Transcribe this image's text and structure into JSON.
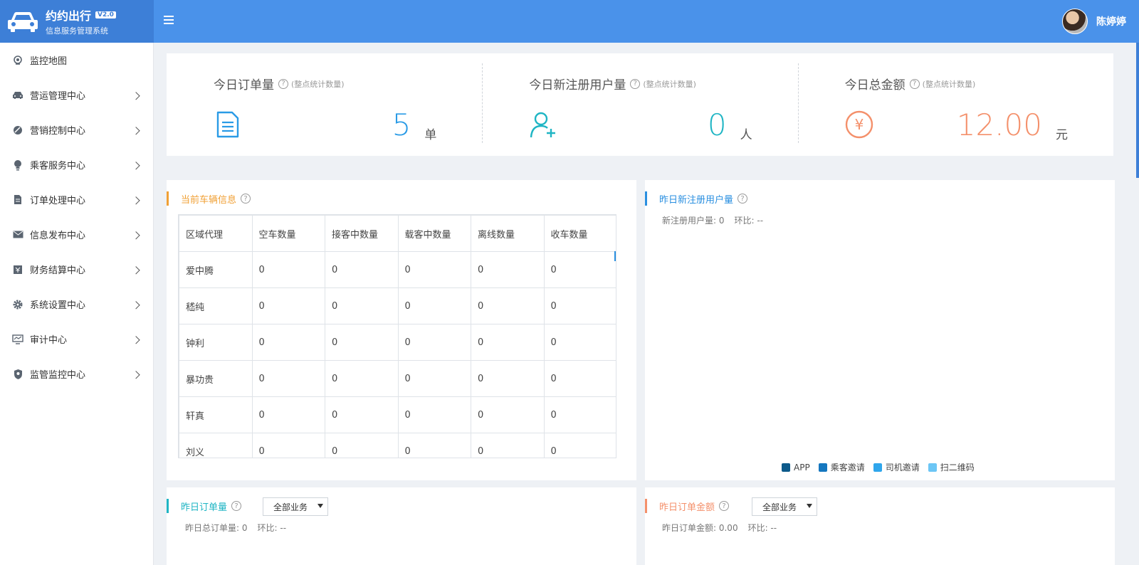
{
  "brand": {
    "name": "约约出行",
    "version": "V2.0",
    "subtitle": "信息服务管理系统"
  },
  "user": {
    "name": "陈婷婷"
  },
  "sidebar": {
    "items": [
      {
        "label": "监控地图",
        "icon": "map-pin-icon"
      },
      {
        "label": "营运管理中心",
        "icon": "car-icon"
      },
      {
        "label": "营销控制中心",
        "icon": "tag-icon"
      },
      {
        "label": "乘客服务中心",
        "icon": "bulb-icon"
      },
      {
        "label": "订单处理中心",
        "icon": "file-icon"
      },
      {
        "label": "信息发布中心",
        "icon": "mail-icon"
      },
      {
        "label": "财务结算中心",
        "icon": "cash-icon"
      },
      {
        "label": "系统设置中心",
        "icon": "gear-icon"
      },
      {
        "label": "审计中心",
        "icon": "monitor-icon"
      },
      {
        "label": "监管监控中心",
        "icon": "shield-icon"
      }
    ]
  },
  "stats": {
    "note": "(整点统计数量)",
    "orders": {
      "title": "今日订单量",
      "value": "5",
      "unit": "单",
      "color": "#2a9be6"
    },
    "users": {
      "title": "今日新注册用户量",
      "value": "0",
      "unit": "人",
      "color": "#1fb5c4"
    },
    "amount": {
      "title": "今日总金额",
      "value": "12.00",
      "unit": "元",
      "color": "#f4906b"
    }
  },
  "vehicles": {
    "title": "当前车辆信息",
    "headers": [
      "区域代理",
      "空车数量",
      "接客中数量",
      "载客中数量",
      "离线数量",
      "收车数量"
    ],
    "rows": [
      [
        "爱中腾",
        "0",
        "0",
        "0",
        "0",
        "0"
      ],
      [
        "嵇纯",
        "0",
        "0",
        "0",
        "0",
        "0"
      ],
      [
        "钟利",
        "0",
        "0",
        "0",
        "0",
        "0"
      ],
      [
        "暴功贵",
        "0",
        "0",
        "0",
        "0",
        "0"
      ],
      [
        "轩真",
        "0",
        "0",
        "0",
        "0",
        "0"
      ],
      [
        "刘义",
        "0",
        "0",
        "0",
        "0",
        "0"
      ]
    ]
  },
  "new_users": {
    "title": "昨日新注册用户量",
    "count_label": "新注册用户量: 0",
    "ratio_label": "环比: --",
    "legend": [
      {
        "name": "APP",
        "color": "#0d5a8a"
      },
      {
        "name": "乘客邀请",
        "color": "#1577bf"
      },
      {
        "name": "司机邀请",
        "color": "#2fa6ec"
      },
      {
        "name": "扫二维码",
        "color": "#6cc6f5"
      }
    ]
  },
  "yesterday_orders": {
    "title": "昨日订单量",
    "select_value": "全部业务",
    "count_label": "昨日总订单量: 0",
    "ratio_label": "环比: --"
  },
  "yesterday_amount": {
    "title": "昨日订单金额",
    "select_value": "全部业务",
    "count_label": "昨日订单金额: 0.00",
    "ratio_label": "环比: --"
  }
}
